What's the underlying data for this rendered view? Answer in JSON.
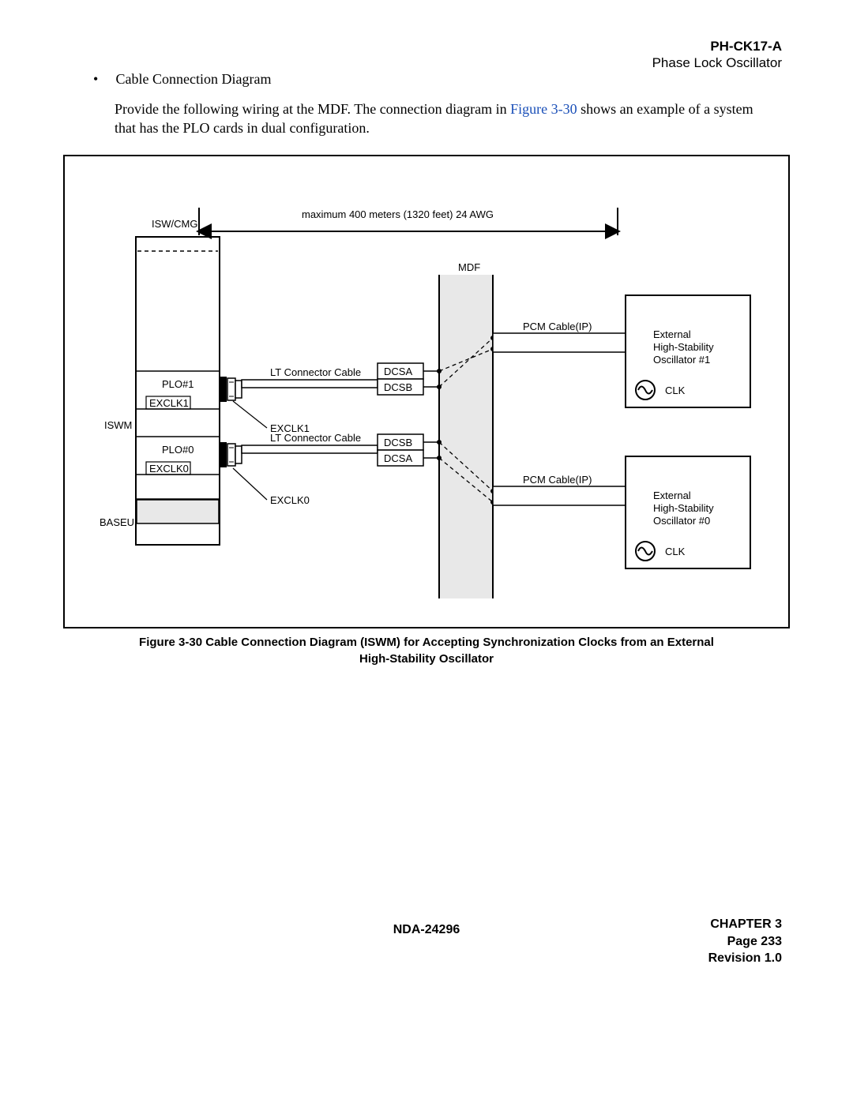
{
  "header": {
    "code": "PH-CK17-A",
    "subtitle": "Phase Lock Oscillator"
  },
  "bullet": {
    "title": "Cable Connection Diagram"
  },
  "para": {
    "pre": "Provide the following wiring at the MDF. The connection diagram in ",
    "linkText": "Figure 3-30",
    "post": " shows an example of a system that has the PLO cards in dual configuration."
  },
  "diagram": {
    "topNote": "maximum 400 meters (1320 feet)   24 AWG",
    "iswCmg": "ISW/CMG",
    "iswm": "ISWM",
    "baseu": "BASEU",
    "plo1": "PLO#1",
    "plo0": "PLO#0",
    "exclk1": "EXCLK1",
    "exclk0": "EXCLK0",
    "exclk1Lbl": "EXCLK1",
    "exclk0Lbl": "EXCLK0",
    "ltConn": "LT Connector Cable",
    "dcsa": "DCSA",
    "dcsb": "DCSB",
    "mdf": "MDF",
    "pcmCable": "PCM Cable(IP)",
    "ext1a": "External",
    "ext1b": "High-Stability",
    "ext1c": "Oscillator #1",
    "ext0a": "External",
    "ext0b": "High-Stability",
    "ext0c": "Oscillator #0",
    "clk": "CLK"
  },
  "caption": {
    "line1": "Figure 3-30   Cable Connection Diagram (ISWM) for Accepting Synchronization Clocks from an External",
    "line2": "High-Stability Oscillator"
  },
  "footer": {
    "docnum": "NDA-24296",
    "chapter": "CHAPTER 3",
    "page": "Page 233",
    "revision": "Revision 1.0"
  }
}
